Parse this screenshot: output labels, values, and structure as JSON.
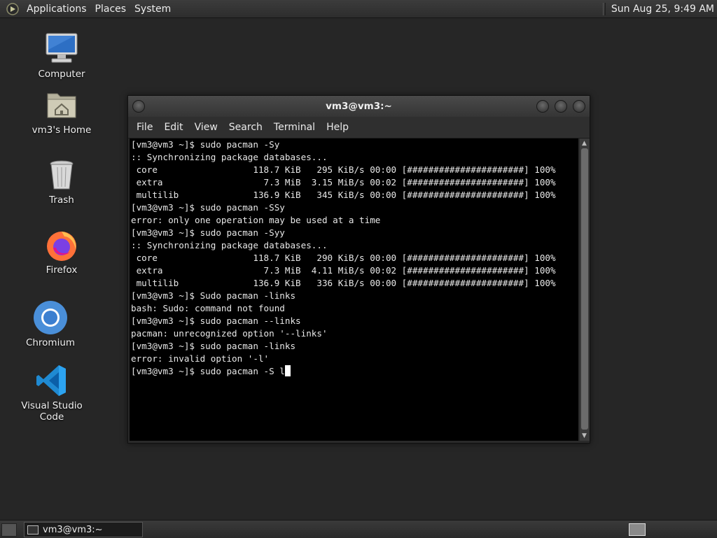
{
  "top_panel": {
    "menus": [
      "Applications",
      "Places",
      "System"
    ],
    "clock": "Sun Aug 25,  9:49 AM"
  },
  "desktop_icons": [
    {
      "label": "Computer",
      "icon": "computer-icon"
    },
    {
      "label": "vm3's Home",
      "icon": "home-folder-icon"
    },
    {
      "label": "Trash",
      "icon": "trash-icon"
    },
    {
      "label": "Firefox",
      "icon": "firefox-icon"
    },
    {
      "label": "Chromium",
      "icon": "chromium-icon"
    },
    {
      "label": "Visual Studio Code",
      "icon": "vscode-icon"
    }
  ],
  "window": {
    "title": "vm3@vm3:~",
    "menus": [
      "File",
      "Edit",
      "View",
      "Search",
      "Terminal",
      "Help"
    ]
  },
  "terminal": {
    "lines": [
      "[vm3@vm3 ~]$ sudo pacman -Sy",
      ":: Synchronizing package databases...",
      " core                  118.7 KiB   295 KiB/s 00:00 [######################] 100%",
      " extra                   7.3 MiB  3.15 MiB/s 00:02 [######################] 100%",
      " multilib              136.9 KiB   345 KiB/s 00:00 [######################] 100%",
      "[vm3@vm3 ~]$ sudo pacman -SSy",
      "error: only one operation may be used at a time",
      "[vm3@vm3 ~]$ sudo pacman -Syy",
      ":: Synchronizing package databases...",
      " core                  118.7 KiB   290 KiB/s 00:00 [######################] 100%",
      " extra                   7.3 MiB  4.11 MiB/s 00:02 [######################] 100%",
      " multilib              136.9 KiB   336 KiB/s 00:00 [######################] 100%",
      "[vm3@vm3 ~]$ Sudo pacman -links",
      "bash: Sudo: command not found",
      "[vm3@vm3 ~]$ sudo pacman --links",
      "pacman: unrecognized option '--links'",
      "[vm3@vm3 ~]$ sudo pacman -links",
      "error: invalid option '-l'"
    ],
    "current_input": "[vm3@vm3 ~]$ sudo pacman -S l"
  },
  "taskbar": {
    "task_label": "vm3@vm3:~"
  },
  "colors": {
    "desktop_bg": "#262626",
    "terminal_bg": "#000000",
    "terminal_fg": "#e8e8e8"
  }
}
